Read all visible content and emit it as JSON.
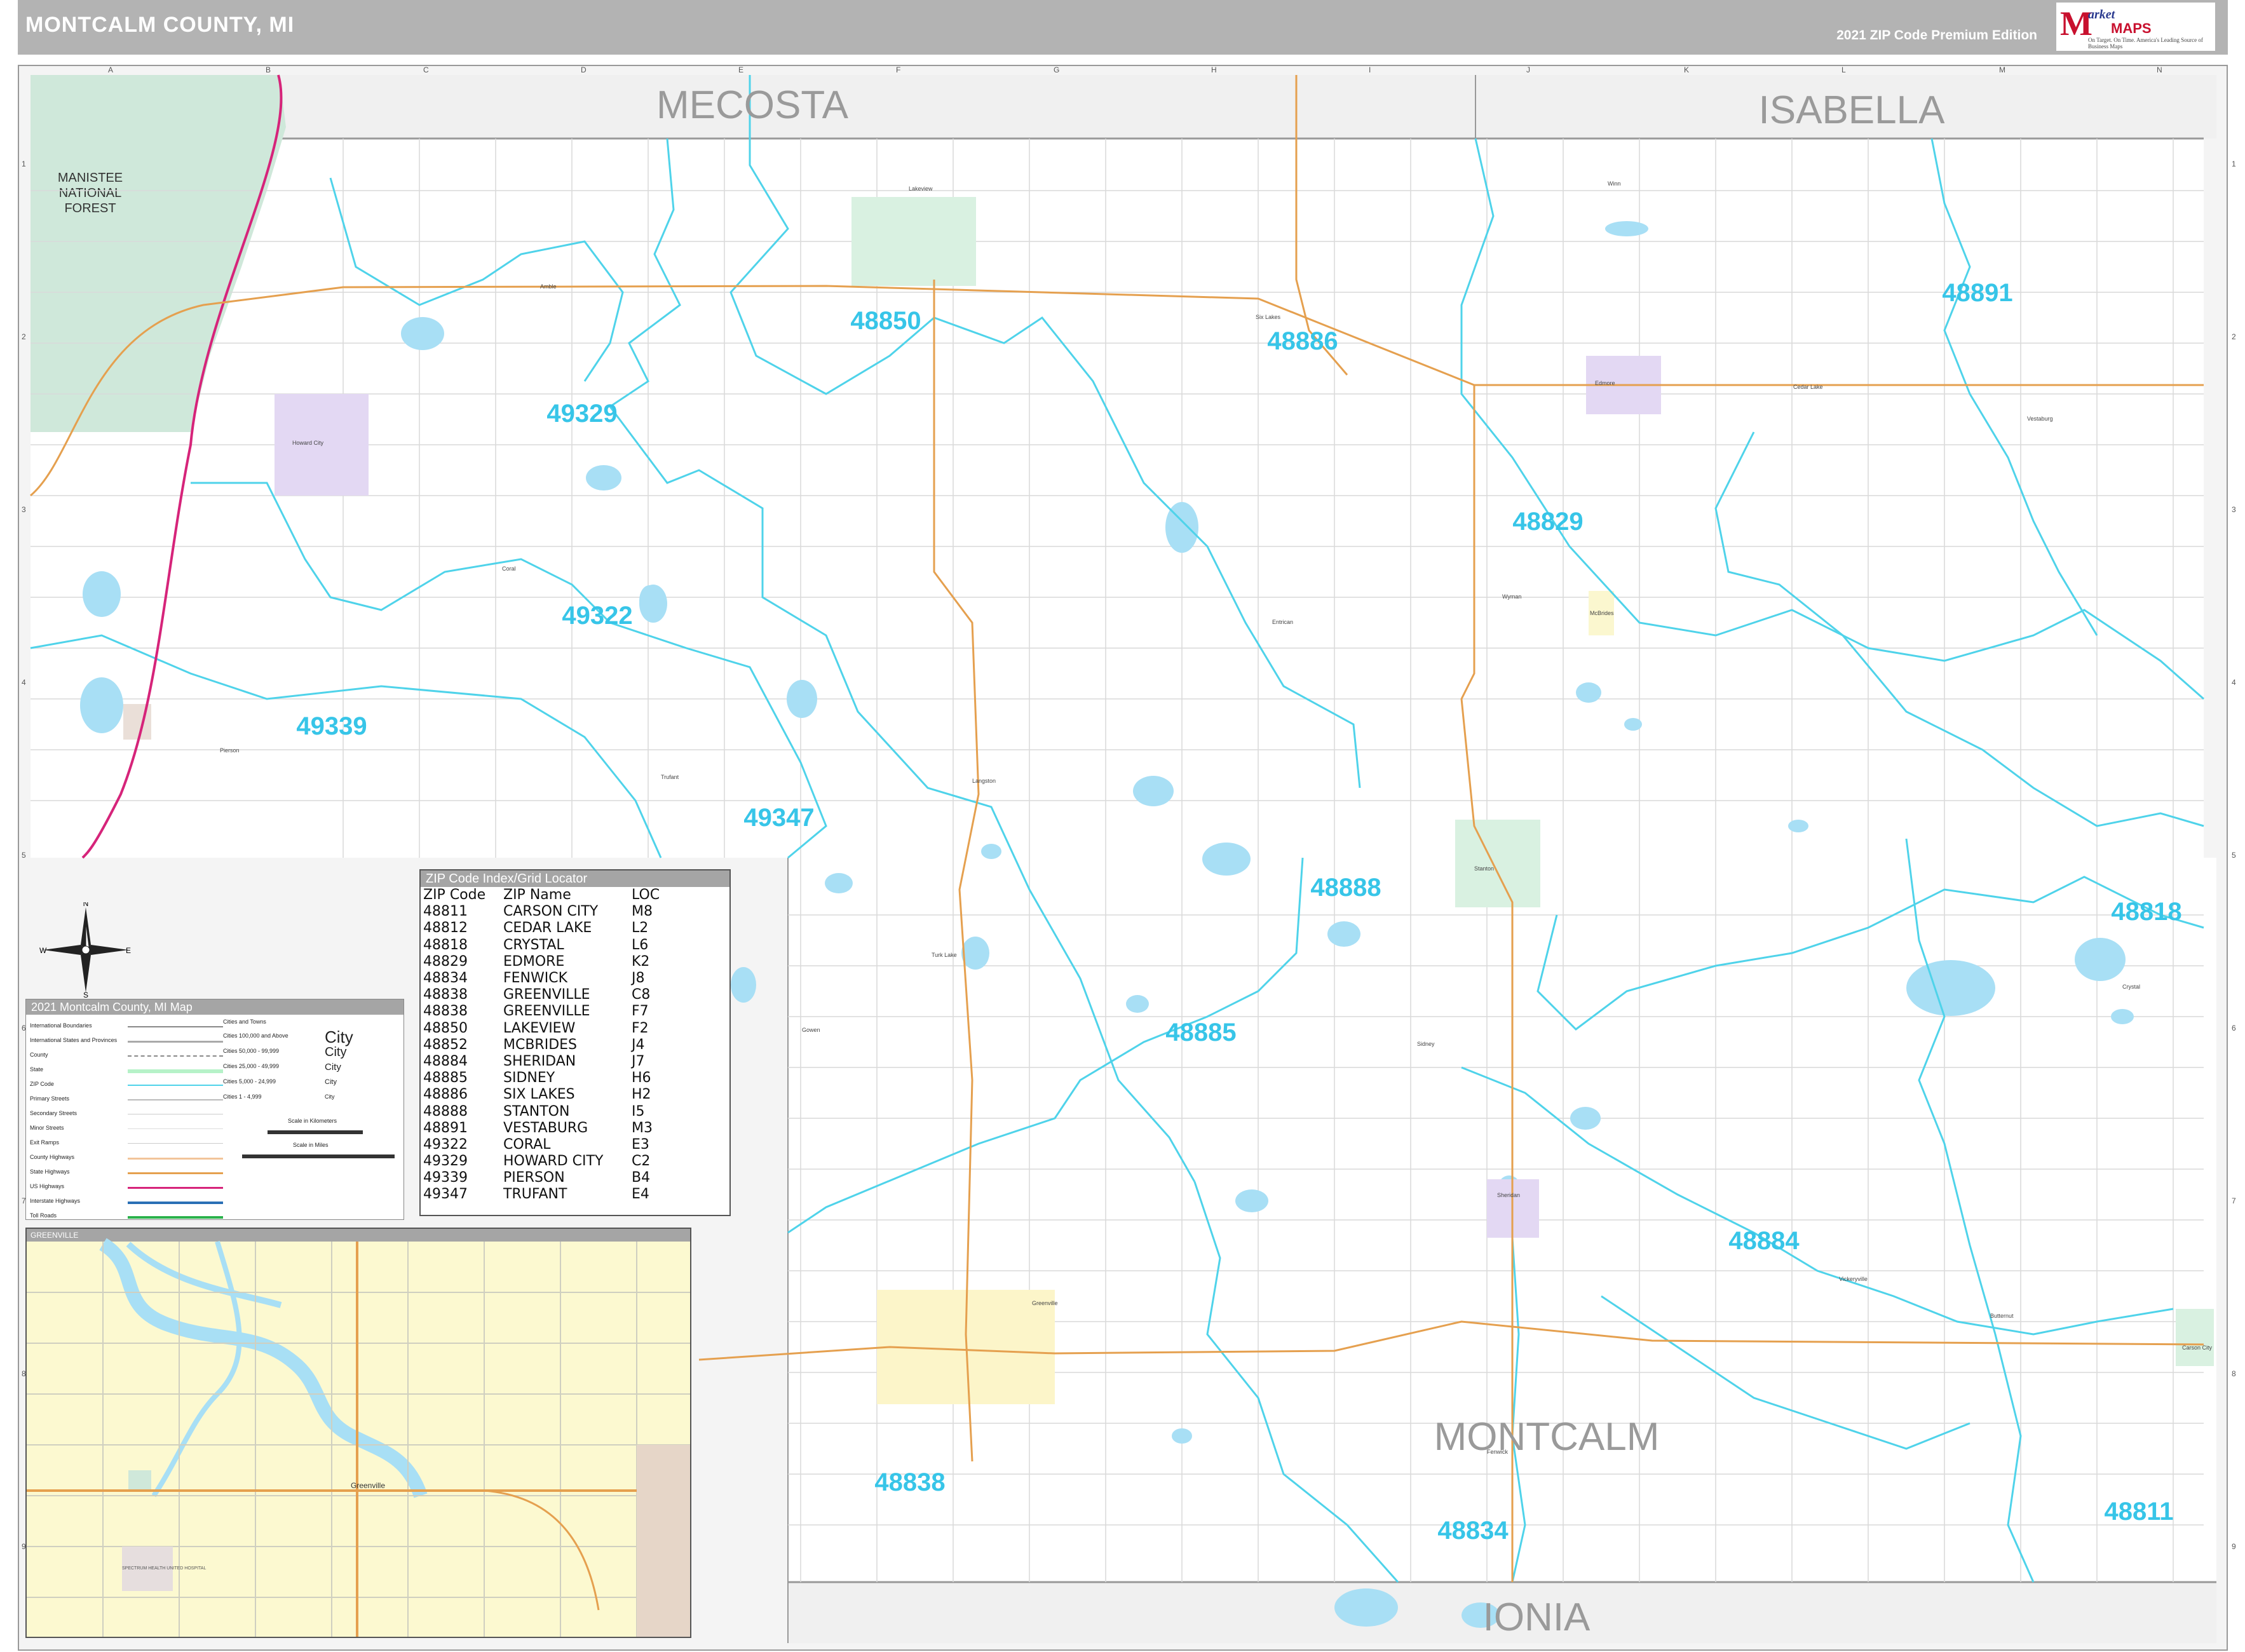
{
  "header": {
    "title": "MONTCALM COUNTY, MI",
    "edition": "2021 ZIP Code Premium Edition",
    "logo": {
      "brand_letter": "M",
      "brand_word": "arket",
      "brand_maps": "MAPS",
      "tagline": "On Target. On Time. America's Leading Source of Business Maps"
    }
  },
  "grid": {
    "columns": [
      "A",
      "B",
      "C",
      "D",
      "E",
      "F",
      "G",
      "H",
      "I",
      "J",
      "K",
      "L",
      "M",
      "N"
    ],
    "rows": [
      "1",
      "2",
      "3",
      "4",
      "5",
      "6",
      "7",
      "8",
      "9"
    ]
  },
  "neighbor_counties": {
    "north_west": "MECOSTA",
    "north_east": "ISABELLA",
    "main": "MONTCALM",
    "south": "IONIA"
  },
  "forest_label": [
    "MANISTEE",
    "NATIONAL",
    "FOREST"
  ],
  "zip_labels": [
    {
      "code": "48850"
    },
    {
      "code": "48886"
    },
    {
      "code": "48891"
    },
    {
      "code": "49329"
    },
    {
      "code": "48829"
    },
    {
      "code": "49322"
    },
    {
      "code": "49339"
    },
    {
      "code": "49347"
    },
    {
      "code": "48888"
    },
    {
      "code": "48818"
    },
    {
      "code": "48885"
    },
    {
      "code": "48884"
    },
    {
      "code": "48838"
    },
    {
      "code": "48834"
    },
    {
      "code": "48811"
    }
  ],
  "place_names": [
    "Lakeview",
    "Six Lakes",
    "Edmore",
    "Cedar Lake",
    "Vestaburg",
    "Howard City",
    "Coral",
    "McBrides",
    "Amble",
    "Langston",
    "Stanton",
    "Turk Lake",
    "Sidney",
    "Greenville",
    "Gowen",
    "Trufant",
    "Pierson",
    "Entrican",
    "Vickeryville",
    "Butternut",
    "Carson City",
    "Crystal",
    "Fenwick",
    "Sheridan",
    "Winn",
    "Wyman"
  ],
  "zip_index": {
    "title": "ZIP Code Index/Grid Locator",
    "headers": [
      "ZIP Code",
      "ZIP Name",
      "LOC"
    ],
    "rows": [
      [
        "48811",
        "CARSON CITY",
        "M8"
      ],
      [
        "48812",
        "CEDAR LAKE",
        "L2"
      ],
      [
        "48818",
        "CRYSTAL",
        "L6"
      ],
      [
        "48829",
        "EDMORE",
        "K2"
      ],
      [
        "48834",
        "FENWICK",
        "J8"
      ],
      [
        "48838",
        "GREENVILLE",
        "C8"
      ],
      [
        "48838",
        "GREENVILLE",
        "F7"
      ],
      [
        "48850",
        "LAKEVIEW",
        "F2"
      ],
      [
        "48852",
        "MCBRIDES",
        "J4"
      ],
      [
        "48884",
        "SHERIDAN",
        "J7"
      ],
      [
        "48885",
        "SIDNEY",
        "H6"
      ],
      [
        "48886",
        "SIX LAKES",
        "H2"
      ],
      [
        "48888",
        "STANTON",
        "I5"
      ],
      [
        "48891",
        "VESTABURG",
        "M3"
      ],
      [
        "49322",
        "CORAL",
        "E3"
      ],
      [
        "49329",
        "HOWARD CITY",
        "C2"
      ],
      [
        "49339",
        "PIERSON",
        "B4"
      ],
      [
        "49347",
        "TRUFANT",
        "E4"
      ]
    ]
  },
  "legend": {
    "title": "2021 Montcalm County, MI Map",
    "line_items": [
      "International Boundaries",
      "International States and Provinces",
      "County",
      "State",
      "ZIP Code",
      "Primary Streets",
      "Secondary Streets",
      "Minor Streets",
      "Exit Ramps",
      "County Highways",
      "State Highways",
      "US Highways",
      "Interstate Highways",
      "Toll Roads"
    ],
    "cities_header": "Cities and Towns",
    "city_items": [
      {
        "label": "Cities 100,000 and Above",
        "sample": "City"
      },
      {
        "label": "Cities 50,000 - 99,999",
        "sample": "City"
      },
      {
        "label": "Cities 25,000 - 49,999",
        "sample": "City"
      },
      {
        "label": "Cities 5,000 - 24,999",
        "sample": "City"
      },
      {
        "label": "Cities 1 - 4,999",
        "sample": "City"
      }
    ],
    "scale_km": "Scale in Kilometers",
    "scale_mi": "Scale in Miles"
  },
  "compass": {
    "n": "N",
    "s": "S",
    "e": "E",
    "w": "W"
  },
  "inset": {
    "title": "GREENVILLE",
    "labels": [
      "Greenville",
      "SPECTRUM HEALTH UNITED HOSPITAL"
    ]
  },
  "colors": {
    "zip_boundary": "#4fd3ea",
    "zip_label": "#37c5e8",
    "water": "#a8dff5",
    "forest": "#cfe8da",
    "highway_us": "#d6247a",
    "highway_state": "#e5a04f",
    "header_bg": "#b3b3b3",
    "inset_bg": "#fcf9d0"
  }
}
